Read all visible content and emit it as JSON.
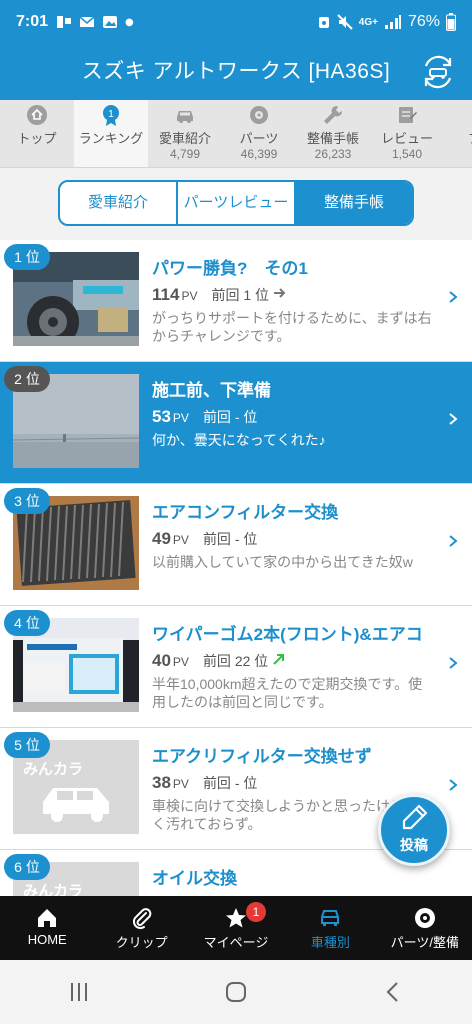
{
  "status_bar": {
    "time": "7:01",
    "network": "4G+",
    "battery": "76%"
  },
  "header": {
    "title": "スズキ アルトワークス [HA36S]"
  },
  "category_tabs": [
    {
      "label": "トップ",
      "count": "",
      "icon": "home-circle-icon"
    },
    {
      "label": "ランキング",
      "count": "",
      "icon": "medal-icon",
      "active": true
    },
    {
      "label": "愛車紹介",
      "count": "4,799",
      "icon": "car-icon"
    },
    {
      "label": "パーツ",
      "count": "46,399",
      "icon": "wheel-icon"
    },
    {
      "label": "整備手帳",
      "count": "26,233",
      "icon": "wrench-icon"
    },
    {
      "label": "レビュー",
      "count": "1,540",
      "icon": "review-icon"
    },
    {
      "label": "プロ",
      "count": "",
      "icon": "pro-icon"
    }
  ],
  "segmented": {
    "options": [
      "愛車紹介",
      "パーツレビュー",
      "整備手帳"
    ],
    "selected": "整備手帳"
  },
  "list": [
    {
      "rank": "1 位",
      "title": "パワー勝負?　その1",
      "pv": "114",
      "pv_unit": "PV",
      "prev": "前回 1 位",
      "trend": "same",
      "desc": "がっちりサポートを付けるために、まずは右からチャレンジです。"
    },
    {
      "rank": "2 位",
      "title": "施工前、下準備",
      "pv": "53",
      "pv_unit": "PV",
      "prev": "前回 - 位",
      "trend": "none",
      "desc": "何か、曇天になってくれた♪",
      "highlight": true
    },
    {
      "rank": "3 位",
      "title": "エアコンフィルター交換",
      "pv": "49",
      "pv_unit": "PV",
      "prev": "前回 - 位",
      "trend": "none",
      "desc": "以前購入していて家の中から出てきた奴w"
    },
    {
      "rank": "4 位",
      "title": "ワイパーゴム2本(フロント)&エアコ",
      "pv": "40",
      "pv_unit": "PV",
      "prev": "前回 22 位",
      "trend": "up",
      "desc": "半年10,000km超えたので定期交換です。使用したのは前回と同じです。"
    },
    {
      "rank": "5 位",
      "title": "エアクリフィルター交換せず",
      "pv": "38",
      "pv_unit": "PV",
      "prev": "前回 - 位",
      "trend": "none",
      "desc": "車検に向けて交換しようかと思ったけど、全く汚れておらず。"
    },
    {
      "rank": "6 位",
      "title": "オイル交換",
      "pv": "",
      "pv_unit": "",
      "prev": "",
      "trend": "none",
      "desc": ""
    }
  ],
  "fab": {
    "label": "投稿"
  },
  "bottom_nav": [
    {
      "label": "HOME",
      "icon": "house-icon"
    },
    {
      "label": "クリップ",
      "icon": "paperclip-icon"
    },
    {
      "label": "マイページ",
      "icon": "star-icon",
      "badge": "1"
    },
    {
      "label": "車種別",
      "icon": "car-front-icon",
      "active": true
    },
    {
      "label": "パーツ/整備",
      "icon": "wheel-icon"
    }
  ],
  "placeholder_logo_text": "みんカラ",
  "colors": {
    "accent": "#1d91cf",
    "badge": "#e53935",
    "up_arrow": "#3cb94a"
  }
}
